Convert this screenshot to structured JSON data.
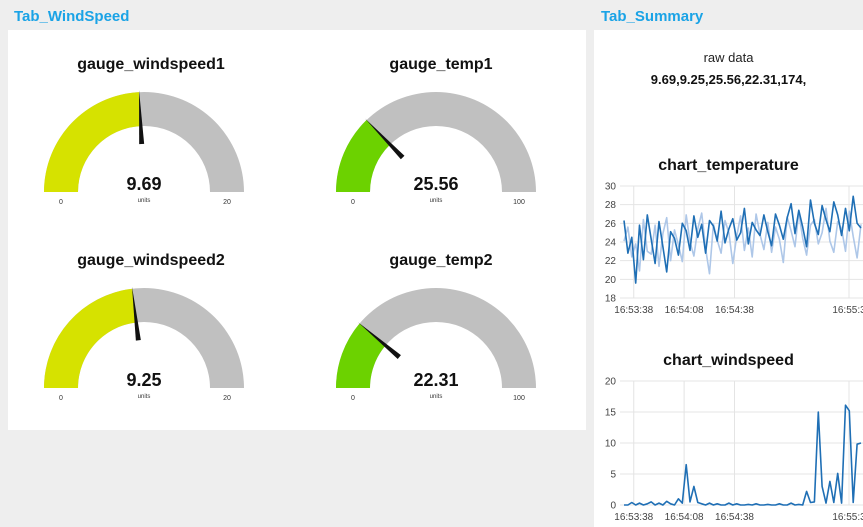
{
  "tabs": {
    "windspeed": "Tab_WindSpeed",
    "summary": "Tab_Summary"
  },
  "colors": {
    "accent": "#1aa3e6",
    "gauge_wind": "#d6e200",
    "gauge_temp": "#6cd200",
    "gauge_bg": "#c0c0c0",
    "series_dark": "#1f6fb5",
    "series_light": "#aec7e8"
  },
  "gauges": [
    {
      "title": "gauge_windspeed1",
      "value": "9.69",
      "units": "units",
      "min": "0",
      "max": "20",
      "level": 0.4845
    },
    {
      "title": "gauge_temp1",
      "value": "25.56",
      "units": "units",
      "min": "0",
      "max": "100",
      "level": 0.2556
    },
    {
      "title": "gauge_windspeed2",
      "value": "9.25",
      "units": "units",
      "min": "0",
      "max": "20",
      "level": 0.4625
    },
    {
      "title": "gauge_temp2",
      "value": "22.31",
      "units": "units",
      "min": "0",
      "max": "100",
      "level": 0.2231
    }
  ],
  "summary": {
    "raw_label": "raw data",
    "raw_value": "9.69,9.25,25.56,22.31,174,"
  },
  "chart_data": [
    {
      "type": "line",
      "title": "chart_temperature",
      "ylim": [
        18,
        30
      ],
      "yticks": [
        "30",
        "28",
        "26",
        "24",
        "22",
        "20",
        "18"
      ],
      "xticks": [
        "16:53:38",
        "16:54:08",
        "16:54:38",
        "16:55:3"
      ],
      "grid": true,
      "series": [
        {
          "values": [
            26.3,
            22.8,
            24.5,
            19.6,
            25.8,
            22.1,
            26.9,
            24.3,
            21.7,
            26.2,
            23.5,
            20.8,
            25.1,
            24.4,
            22.6,
            26.0,
            25.2,
            23.1,
            26.8,
            24.5,
            25.9,
            22.8,
            26.3,
            25.7,
            24.1,
            27.3,
            23.9,
            25.4,
            26.5,
            24.2,
            25.0,
            27.6,
            23.8,
            26.1,
            25.3,
            24.7,
            26.9,
            25.1,
            23.6,
            27.0,
            25.8,
            24.3,
            26.6,
            28.1,
            24.9,
            27.4,
            25.6,
            23.5,
            28.5,
            26.0,
            24.8,
            27.9,
            26.4,
            25.1,
            28.3,
            26.9,
            24.7,
            27.6,
            25.2,
            28.9,
            26.0,
            25.5
          ]
        },
        {
          "values": [
            24.1,
            25.6,
            22.4,
            23.8,
            20.9,
            26.4,
            23.0,
            22.7,
            25.8,
            21.4,
            24.9,
            26.6,
            22.0,
            25.3,
            23.7,
            21.9,
            26.9,
            24.0,
            22.5,
            25.4,
            27.1,
            23.3,
            20.6,
            25.9,
            24.2,
            22.8,
            26.3,
            25.0,
            21.7,
            24.6,
            26.8,
            23.1,
            25.5,
            22.4,
            27.0,
            24.8,
            23.2,
            26.1,
            22.9,
            25.6,
            24.3,
            21.8,
            26.7,
            25.2,
            23.5,
            27.2,
            24.4,
            22.6,
            25.8,
            26.4,
            23.8,
            25.0,
            27.6,
            24.1,
            22.9,
            26.2,
            25.4,
            23.0,
            27.3,
            24.6,
            22.3,
            25.9
          ]
        }
      ]
    },
    {
      "type": "line",
      "title": "chart_windspeed",
      "ylim": [
        0,
        20
      ],
      "yticks": [
        "20",
        "15",
        "10",
        "5",
        "0"
      ],
      "xticks": [
        "16:53:38",
        "16:54:08",
        "16:54:38",
        "16:55:3"
      ],
      "grid": true,
      "series": [
        {
          "values": [
            0,
            0,
            0.4,
            0,
            0.3,
            0,
            0.2,
            0.5,
            0,
            0.3,
            0,
            0.6,
            0.2,
            0,
            1.0,
            0.3,
            6.5,
            0.5,
            3.0,
            0.4,
            0.2,
            0,
            0.3,
            0,
            0.2,
            0,
            0,
            0.3,
            0,
            0.2,
            0,
            0,
            0.1,
            0,
            0.2,
            0,
            0,
            0.1,
            0,
            0,
            0.2,
            0,
            0,
            0.3,
            0,
            0.1,
            0,
            2.2,
            0.4,
            0.5,
            15.0,
            3.0,
            0.3,
            3.8,
            0.4,
            5.1,
            0.3,
            16.1,
            15.2,
            0.4,
            9.8,
            10.0
          ]
        }
      ]
    }
  ]
}
